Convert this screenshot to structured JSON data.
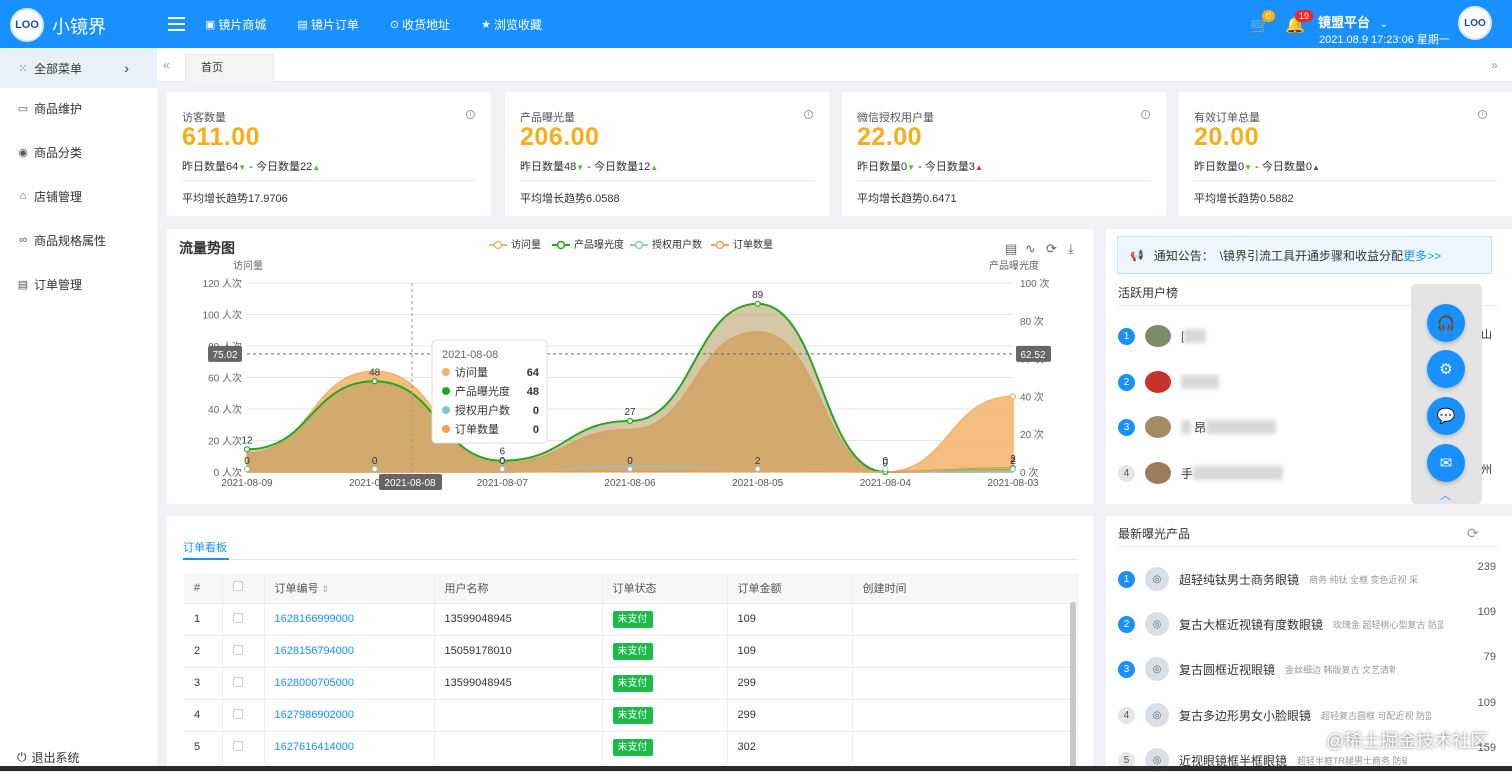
{
  "header": {
    "logo_text": "LOO",
    "app_title": "小镜界",
    "nav": [
      {
        "label": "镜片商城",
        "icon": "store-icon"
      },
      {
        "label": "镜片订单",
        "icon": "order-icon"
      },
      {
        "label": "收货地址",
        "icon": "location-icon"
      },
      {
        "label": "浏览收藏",
        "icon": "star-icon"
      }
    ],
    "cart_badge": "0",
    "bell_badge": "19",
    "platform": "镜盟平台",
    "datetime": "2021.08.9 17:23:06 星期一",
    "avatar_text": "LOO"
  },
  "sidebar": {
    "items": [
      {
        "label": "全部菜单"
      },
      {
        "label": "商品维护"
      },
      {
        "label": "商品分类"
      },
      {
        "label": "店铺管理"
      },
      {
        "label": "商品规格属性"
      },
      {
        "label": "订单管理"
      }
    ],
    "logout": "退出系统"
  },
  "tabs": {
    "home": "首页"
  },
  "stats": [
    {
      "title": "访客数量",
      "value": "611.00",
      "yesterday": "昨日数量64",
      "today": "今日数量22",
      "trend": "平均增长趋势17.9706"
    },
    {
      "title": "产品曝光量",
      "value": "206.00",
      "yesterday": "昨日数量48",
      "today": "今日数量12",
      "trend": "平均增长趋势6.0588"
    },
    {
      "title": "微信授权用户量",
      "value": "22.00",
      "yesterday": "昨日数量0",
      "today": "今日数量3",
      "trend": "平均增长趋势0.6471"
    },
    {
      "title": "有效订单总量",
      "value": "20.00",
      "yesterday": "昨日数量0",
      "today": "今日数量0",
      "trend": "平均增长趋势0.5882"
    }
  ],
  "chart_data": {
    "type": "area",
    "title": "流量势图",
    "ylabel": "访问量",
    "y2label": "产品曝光度",
    "ylim": [
      0,
      120
    ],
    "y2lim": [
      0,
      100
    ],
    "yticks": [
      "0 人次",
      "20 人次",
      "40 人次",
      "60 人次",
      "80 人次",
      "100 人次",
      "120 人次"
    ],
    "y2ticks": [
      "0 次",
      "20 次",
      "40 次",
      "60 次",
      "80 次",
      "100 次"
    ],
    "x": [
      "2021-08-09",
      "2021-08-08",
      "2021-08-07",
      "2021-08-06",
      "2021-08-05",
      "2021-08-04",
      "2021-08-03"
    ],
    "legend_position": "top-center",
    "series": [
      {
        "name": "访问量",
        "values": [
          12,
          64,
          6,
          27,
          89,
          0,
          48
        ],
        "color": "#f5b26a"
      },
      {
        "name": "产品曝光度",
        "values": [
          12,
          48,
          6,
          27,
          89,
          0,
          2
        ],
        "color": "#22a81f"
      },
      {
        "name": "授权用户数",
        "values": [
          0,
          0,
          0,
          3,
          2,
          0,
          0
        ],
        "color": "#83c8d6"
      },
      {
        "name": "订单数量",
        "values": [
          0,
          0,
          0,
          2,
          2,
          0,
          2
        ],
        "color": "#f0a05a"
      }
    ],
    "point_labels": [
      "12",
      "48",
      "6",
      "27",
      "89",
      "0",
      "2"
    ],
    "zero_labels": [
      "0",
      "0",
      "0",
      "0",
      "2",
      "0",
      "2"
    ],
    "markline_left": "75.02",
    "markline_right": "62.52",
    "tooltip": {
      "date": "2021-08-08",
      "rows": [
        {
          "name": "访问量",
          "value": "64"
        },
        {
          "name": "产品曝光度",
          "value": "48"
        },
        {
          "name": "授权用户数",
          "value": "0"
        },
        {
          "name": "订单数量",
          "value": "0"
        }
      ]
    },
    "axis_pointer_label": "2021-08-08"
  },
  "orders": {
    "tab": "订单看板",
    "columns": [
      "#",
      "",
      "订单编号",
      "用户名称",
      "订单状态",
      "订单金额",
      "创建时间"
    ],
    "rows": [
      {
        "idx": "1",
        "no": "1628166999000",
        "user": "13599048945",
        "status": "未支付",
        "amount": "109",
        "time": ""
      },
      {
        "idx": "2",
        "no": "1628156794000",
        "user": "15059178010",
        "status": "未支付",
        "amount": "109",
        "time": ""
      },
      {
        "idx": "3",
        "no": "1628000705000",
        "user": "13599048945",
        "status": "未支付",
        "amount": "299",
        "time": ""
      },
      {
        "idx": "4",
        "no": "1627986902000",
        "user": "",
        "status": "未支付",
        "amount": "299",
        "time": ""
      },
      {
        "idx": "5",
        "no": "1627616414000",
        "user": "",
        "status": "未支付",
        "amount": "302",
        "time": ""
      }
    ]
  },
  "notice": {
    "label": "通知公告：",
    "text": "\\镜界引流工具开通步骤和收益分配",
    "more": "更多>>"
  },
  "active_users": {
    "title": "活跃用户榜",
    "rows": [
      {
        "rank": "1",
        "name": "[",
        "city": "佛山"
      },
      {
        "rank": "2",
        "name": "",
        "city": ""
      },
      {
        "rank": "3",
        "name": "昂",
        "city": ""
      },
      {
        "rank": "4",
        "name": "手",
        "city": "广州"
      }
    ]
  },
  "latest_products": {
    "title": "最新曝光产品",
    "rows": [
      {
        "rank": "1",
        "name": "超轻纯钛男士商务眼镜",
        "tags": "商务 纯钛 全框 变色近视 采...",
        "count": "239"
      },
      {
        "rank": "2",
        "name": "复古大框近视镜有度数眼镜",
        "tags": "玫瑰金 超轻桃心型复古 防蓝光...",
        "count": "109"
      },
      {
        "rank": "3",
        "name": "复古圆框近视眼镜",
        "tags": "金丝细边 韩版复古 文艺清新...",
        "count": "79"
      },
      {
        "rank": "4",
        "name": "复古多边形男女小脸眼镜",
        "tags": "超轻复古圆框 可配近视 防蓝光...",
        "count": "109"
      },
      {
        "rank": "5",
        "name": "近视眼镜框半框眼镜",
        "tags": "超轻半框TR腿男士商务 防辐射...",
        "count": "159"
      }
    ]
  },
  "watermark": "@稀土掘金技术社区"
}
